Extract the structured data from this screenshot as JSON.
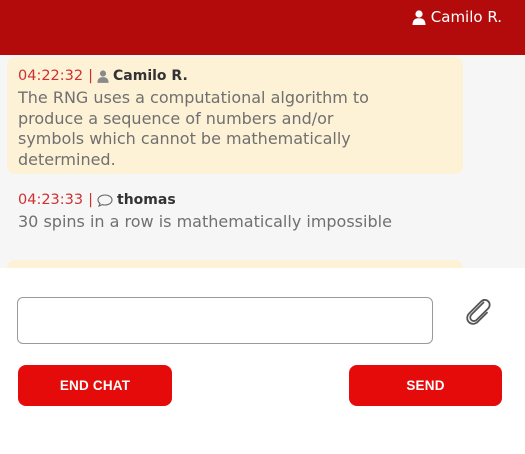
{
  "header": {
    "user_name": "Camilo R."
  },
  "messages": [
    {
      "time": "04:22:32",
      "separator": "|",
      "sender": "Camilo R.",
      "role": "agent",
      "icon": "user-icon",
      "text": "The RNG uses a computational algorithm to produce a sequence of numbers and/or symbols which cannot be mathematically determined."
    },
    {
      "time": "04:23:33",
      "separator": "|",
      "sender": "thomas",
      "role": "user",
      "icon": "chat-bubble-icon",
      "text": "30 spins in a row is mathematically impossible"
    }
  ],
  "composer": {
    "input_value": "",
    "input_placeholder": "",
    "attach_icon": "paperclip-icon"
  },
  "buttons": {
    "end_chat": "END CHAT",
    "send": "SEND"
  },
  "colors": {
    "header": "#b30b0b",
    "button": "#e50b0b",
    "agent_bubble": "#fdf1d6",
    "timestamp": "#d03030"
  }
}
